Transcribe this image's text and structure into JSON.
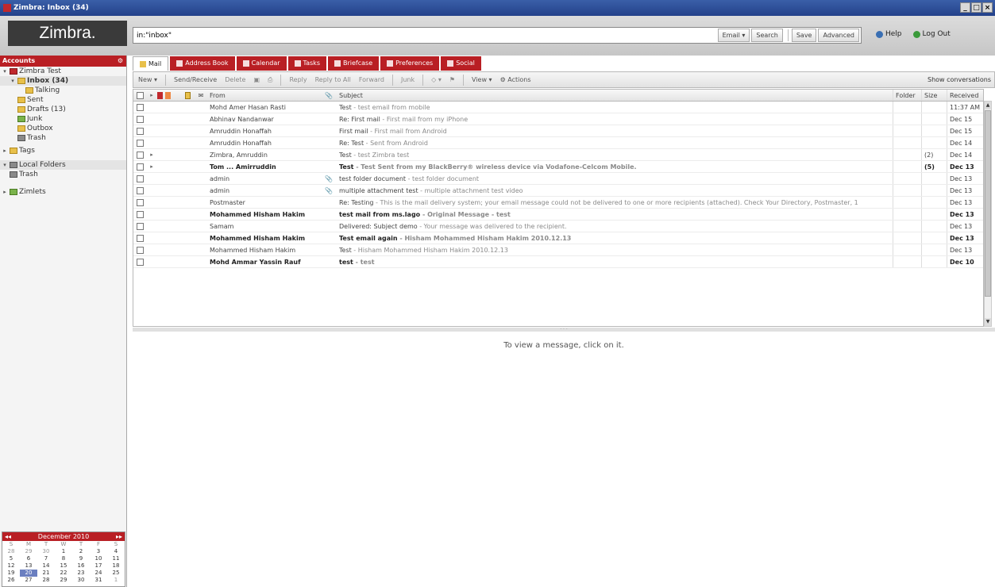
{
  "window": {
    "title": "Zimbra: Inbox (34)"
  },
  "header": {
    "logo": "Zimbra.",
    "search_value": "in:\"inbox\"",
    "search_menu": "Email",
    "search_button": "Search",
    "save_button": "Save",
    "advanced_button": "Advanced",
    "help": "Help",
    "logout": "Log Out"
  },
  "sidebar": {
    "section": "Accounts",
    "account": "Zimbra Test",
    "inbox": "Inbox (34)",
    "subfolder": "Talking",
    "sent": "Sent",
    "drafts": "Drafts (13)",
    "junk": "Junk",
    "outbox": "Outbox",
    "trash": "Trash",
    "tags": "Tags",
    "local": "Local Folders",
    "local_trash": "Trash",
    "zimlets": "Zimlets"
  },
  "calendar": {
    "month": "December 2010",
    "prev": "◂◂",
    "next": "▸▸",
    "dows": [
      "S",
      "M",
      "T",
      "W",
      "T",
      "F",
      "S"
    ],
    "weeks": [
      [
        "28",
        "29",
        "30",
        "1",
        "2",
        "3",
        "4"
      ],
      [
        "5",
        "6",
        "7",
        "8",
        "9",
        "10",
        "11"
      ],
      [
        "12",
        "13",
        "14",
        "15",
        "16",
        "17",
        "18"
      ],
      [
        "19",
        "20",
        "21",
        "22",
        "23",
        "24",
        "25"
      ],
      [
        "26",
        "27",
        "28",
        "29",
        "30",
        "31",
        "1"
      ]
    ]
  },
  "apps": {
    "mail": "Mail",
    "address_book": "Address Book",
    "calendar": "Calendar",
    "tasks": "Tasks",
    "briefcase": "Briefcase",
    "preferences": "Preferences",
    "social": "Social"
  },
  "toolbar": {
    "new": "New",
    "get_mail": "Send/Receive",
    "delete": "Delete",
    "reply": "Reply",
    "reply_all": "Reply to All",
    "forward": "Forward",
    "junk": "Junk",
    "view": "View",
    "actions": "Actions",
    "show_convs": "Show conversations"
  },
  "columns": {
    "from": "From",
    "subject": "Subject",
    "folder": "Folder",
    "size": "Size",
    "received": "Received"
  },
  "messages": [
    {
      "from": "Mohd Amer Hasan Rasti",
      "subject": "Test",
      "fragment": " - test email from mobile",
      "att": "",
      "size": "",
      "date": "11:37 AM",
      "unread": false
    },
    {
      "from": "Abhinav Nandanwar",
      "subject": "Re: First mail",
      "fragment": " - First mail from my iPhone",
      "att": "",
      "size": "",
      "date": "Dec 15",
      "unread": false
    },
    {
      "from": "Amruddin Honaffah",
      "subject": "First mail",
      "fragment": " - First mail from Android",
      "att": "",
      "size": "",
      "date": "Dec 15",
      "unread": false
    },
    {
      "from": "Amruddin Honaffah",
      "subject": "Re: Test",
      "fragment": " - Sent from Android",
      "att": "",
      "size": "",
      "date": "Dec 14",
      "unread": false
    },
    {
      "from": "Zimbra, Amruddin",
      "subject": "Test",
      "fragment": " - test Zimbra test",
      "att": "",
      "size": "(2)",
      "date": "Dec 14",
      "unread": false
    },
    {
      "from": "Tom ... Amirruddin",
      "subject": "Test",
      "fragment": " - Test Sent from my BlackBerry® wireless device via Vodafone-Celcom Mobile.",
      "att": "",
      "size": "(5)",
      "date": "Dec 13",
      "unread": true
    },
    {
      "from": "admin",
      "subject": "test folder document",
      "fragment": " - test folder document",
      "att": "📎",
      "size": "",
      "date": "Dec 13",
      "unread": false
    },
    {
      "from": "admin",
      "subject": "multiple attachment test",
      "fragment": " - multiple attachment test video",
      "att": "📎",
      "size": "",
      "date": "Dec 13",
      "unread": false
    },
    {
      "from": "Postmaster",
      "subject": "Re: Testing",
      "fragment": " - This is the mail delivery system; your email message could not be delivered to one or more recipients (attached). Check Your Directory, Postmaster, 1",
      "att": "",
      "size": "",
      "date": "Dec 13",
      "unread": false
    },
    {
      "from": "Mohammed Hisham Hakim",
      "subject": "test mail from ms.lago",
      "fragment": " - Original Message - test",
      "att": "",
      "size": "",
      "date": "Dec 13",
      "unread": true
    },
    {
      "from": "Samam",
      "subject": "Delivered: Subject demo",
      "fragment": " - Your message was delivered to the recipient.",
      "att": "",
      "size": "",
      "date": "Dec 13",
      "unread": false
    },
    {
      "from": "Mohammed Hisham Hakim",
      "subject": "Test email again",
      "fragment": " - Hisham Mohammed Hisham Hakim 2010.12.13",
      "att": "",
      "size": "",
      "date": "Dec 13",
      "unread": true
    },
    {
      "from": "Mohammed Hisham Hakim",
      "subject": "Test",
      "fragment": " - Hisham Mohammed Hisham Hakim 2010.12.13",
      "att": "",
      "size": "",
      "date": "Dec 13",
      "unread": false
    },
    {
      "from": "Mohd Ammar Yassin Rauf",
      "subject": "test",
      "fragment": " - test",
      "att": "",
      "size": "",
      "date": "Dec 10",
      "unread": true
    }
  ],
  "reading_pane": {
    "empty_text": "To view a message, click on it."
  }
}
